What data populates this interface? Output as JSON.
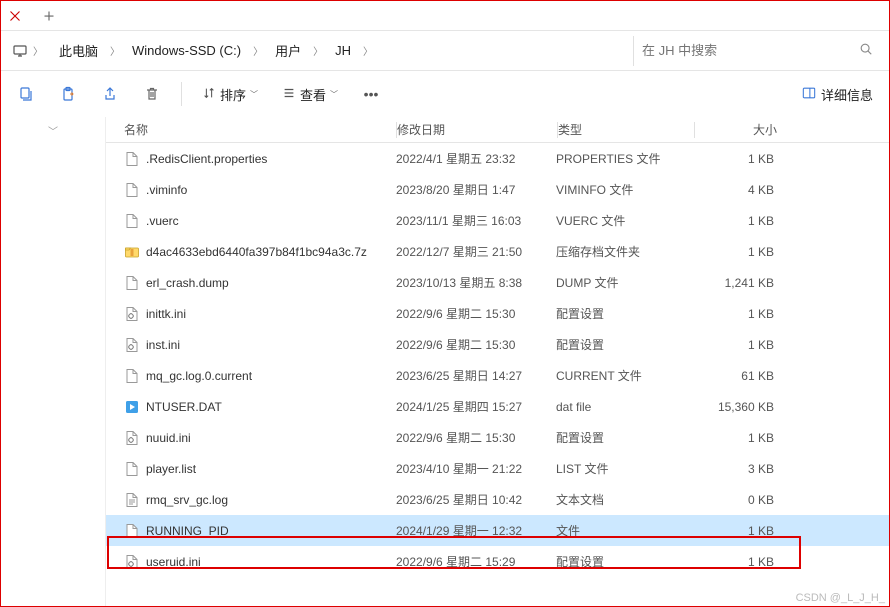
{
  "breadcrumbs": [
    "此电脑",
    "Windows-SSD (C:)",
    "用户",
    "JH"
  ],
  "search": {
    "placeholder": "在 JH 中搜索"
  },
  "toolbar": {
    "sort": "排序",
    "view": "查看",
    "details": "详细信息"
  },
  "columns": {
    "name": "名称",
    "date": "修改日期",
    "type": "类型",
    "size": "大小"
  },
  "files": [
    {
      "icon": "file",
      "name": ".RedisClient.properties",
      "date": "2022/4/1 星期五 23:32",
      "type": "PROPERTIES 文件",
      "size": "1 KB",
      "sel": false
    },
    {
      "icon": "file",
      "name": ".viminfo",
      "date": "2023/8/20 星期日 1:47",
      "type": "VIMINFO 文件",
      "size": "4 KB",
      "sel": false
    },
    {
      "icon": "file",
      "name": ".vuerc",
      "date": "2023/11/1 星期三 16:03",
      "type": "VUERC 文件",
      "size": "1 KB",
      "sel": false
    },
    {
      "icon": "zip",
      "name": "d4ac4633ebd6440fa397b84f1bc94a3c.7z",
      "date": "2022/12/7 星期三 21:50",
      "type": "压缩存档文件夹",
      "size": "1 KB",
      "sel": false
    },
    {
      "icon": "file",
      "name": "erl_crash.dump",
      "date": "2023/10/13 星期五 8:38",
      "type": "DUMP 文件",
      "size": "1,241 KB",
      "sel": false
    },
    {
      "icon": "ini",
      "name": "inittk.ini",
      "date": "2022/9/6 星期二 15:30",
      "type": "配置设置",
      "size": "1 KB",
      "sel": false
    },
    {
      "icon": "ini",
      "name": "inst.ini",
      "date": "2022/9/6 星期二 15:30",
      "type": "配置设置",
      "size": "1 KB",
      "sel": false
    },
    {
      "icon": "file",
      "name": "mq_gc.log.0.current",
      "date": "2023/6/25 星期日 14:27",
      "type": "CURRENT 文件",
      "size": "61 KB",
      "sel": false
    },
    {
      "icon": "dat",
      "name": "NTUSER.DAT",
      "date": "2024/1/25 星期四 15:27",
      "type": "dat file",
      "size": "15,360 KB",
      "sel": false
    },
    {
      "icon": "ini",
      "name": "nuuid.ini",
      "date": "2022/9/6 星期二 15:30",
      "type": "配置设置",
      "size": "1 KB",
      "sel": false
    },
    {
      "icon": "file",
      "name": "player.list",
      "date": "2023/4/10 星期一 21:22",
      "type": "LIST 文件",
      "size": "3 KB",
      "sel": false
    },
    {
      "icon": "txt",
      "name": "rmq_srv_gc.log",
      "date": "2023/6/25 星期日 10:42",
      "type": "文本文档",
      "size": "0 KB",
      "sel": false
    },
    {
      "icon": "file",
      "name": "RUNNING_PID",
      "date": "2024/1/29 星期一 12:32",
      "type": "文件",
      "size": "1 KB",
      "sel": true
    },
    {
      "icon": "ini",
      "name": "useruid.ini",
      "date": "2022/9/6 星期二 15:29",
      "type": "配置设置",
      "size": "1 KB",
      "sel": false
    }
  ],
  "watermark": "CSDN @_L_J_H_"
}
